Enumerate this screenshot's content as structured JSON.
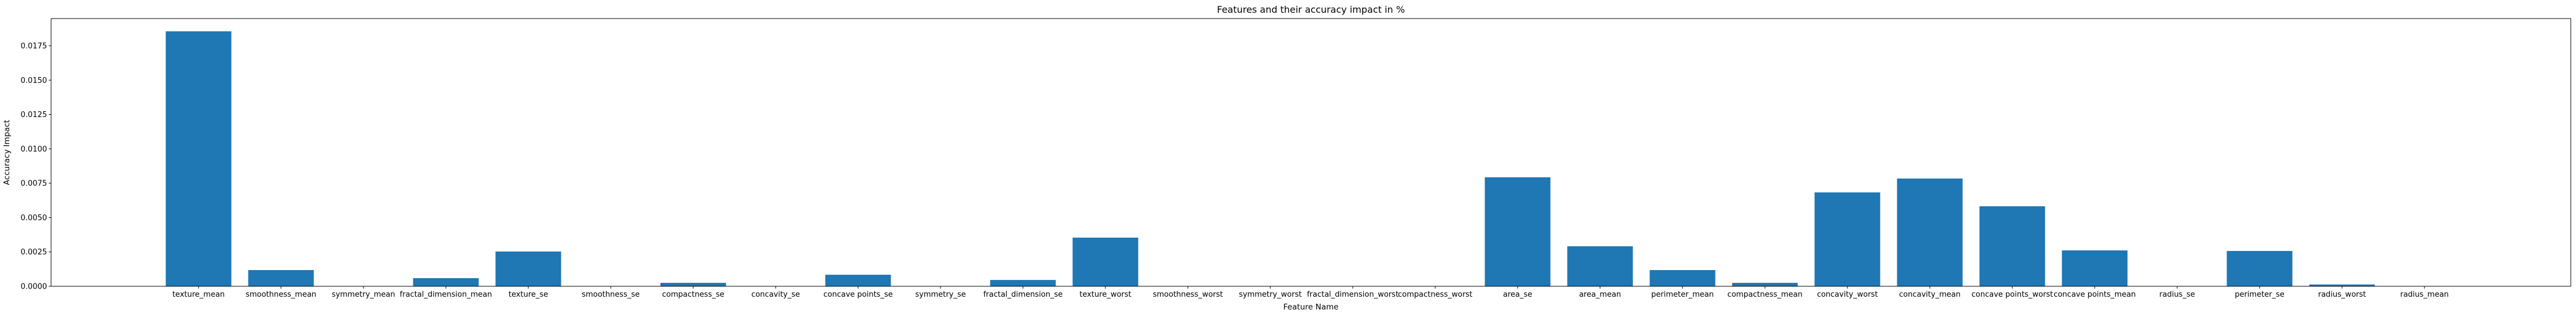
{
  "chart_data": {
    "type": "bar",
    "title": "Features and their accuracy impact in %",
    "xlabel": "Feature Name",
    "ylabel": "Accuracy Impact",
    "ylim": [
      0,
      0.01948
    ],
    "yticks": [
      0.0,
      0.0025,
      0.005,
      0.0075,
      0.01,
      0.0125,
      0.015,
      0.0175
    ],
    "ytick_labels": [
      "0.0000",
      "0.0025",
      "0.0050",
      "0.0075",
      "0.0100",
      "0.0125",
      "0.0150",
      "0.0175"
    ],
    "grid": false,
    "legend": null,
    "bar_color": "#1f77b4",
    "categories": [
      "texture_mean",
      "smoothness_mean",
      "symmetry_mean",
      "fractal_dimension_mean",
      "texture_se",
      "smoothness_se",
      "compactness_se",
      "concavity_se",
      "concave points_se",
      "symmetry_se",
      "fractal_dimension_se",
      "texture_worst",
      "smoothness_worst",
      "symmetry_worst",
      "fractal_dimension_worst",
      "compactness_worst",
      "area_se",
      "area_mean",
      "perimeter_mean",
      "compactness_mean",
      "concavity_worst",
      "concavity_mean",
      "concave points_worst",
      "concave points_mean",
      "radius_se",
      "perimeter_se",
      "radius_worst",
      "radius_mean"
    ],
    "values": [
      0.01855,
      0.00118,
      0.0,
      0.00059,
      0.00253,
      0.0,
      0.00025,
      0.0,
      0.00084,
      0.0,
      0.00046,
      0.00354,
      0.0,
      0.0,
      0.0,
      0.0,
      0.00793,
      0.00291,
      0.00118,
      0.00025,
      0.00683,
      0.00784,
      0.00582,
      0.00261,
      0.0,
      0.00257,
      0.00013,
      0.0
    ]
  }
}
